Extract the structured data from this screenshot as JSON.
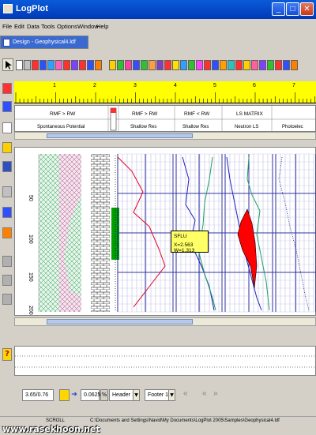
{
  "window": {
    "title": "LogPlot"
  },
  "menu": [
    "File",
    "Edit",
    "Data",
    "Tools",
    "Options",
    "Window",
    "Help"
  ],
  "document_tab": {
    "label": "Design - Geophysical4.ldf"
  },
  "ruler": {
    "labels": [
      "1",
      "2",
      "3",
      "4",
      "5",
      "6",
      "7"
    ]
  },
  "header": {
    "titles": [
      "RMF > RW",
      "RMF > RW",
      "RMF < RW",
      "LS MATRIX"
    ],
    "subtitles": [
      "Spontaneous Potential",
      "Shallow Res",
      "Shallow Res",
      "Neutron LS",
      "Photoelec"
    ]
  },
  "plot": {
    "depth_labels": [
      "50",
      "100",
      "150",
      "200"
    ]
  },
  "tooltip": {
    "line1": "SFLU",
    "line2": "X=2.563 W=1.313"
  },
  "bottombar": {
    "scale_value": "3.65/0.76",
    "depth_scale": "0.0625",
    "pct_label": "%",
    "header_select": "Header 1",
    "footer_select": "Footer 1",
    "nav_prev": "«",
    "nav_next": "»"
  },
  "status": {
    "mode": "SCROLL",
    "file_path": "C:\\Documents and Settings\\Navid\\My Documents\\LogPlot 2005\\Samples\\Geophysical4.ldf"
  },
  "watermark": "www.rasekhoon.net",
  "colors": {
    "title_bar": "#0a5bd8",
    "ruler": "#ffff00",
    "lithology": "#ff0000",
    "grid": "#00008b",
    "green_bar": "#00a000",
    "tooltip": "#ffff66"
  }
}
